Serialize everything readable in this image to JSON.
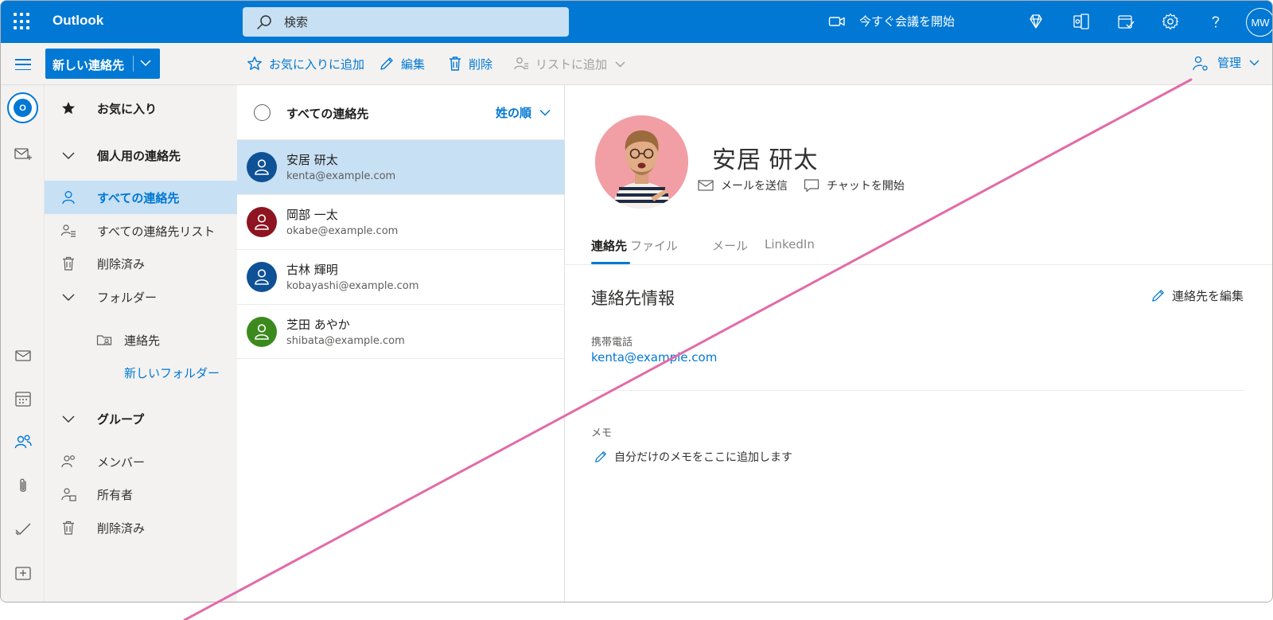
{
  "header": {
    "app_name": "Outlook",
    "search_placeholder": "検索",
    "meet_now": "今すぐ会議を開始",
    "user_initials": "MW"
  },
  "toolbar": {
    "new_contact": "新しい連絡先",
    "add_favorite": "お気に入りに追加",
    "edit": "編集",
    "delete": "削除",
    "add_to_list": "リストに追加",
    "manage": "管理"
  },
  "nav": {
    "favorites": "お気に入り",
    "personal_contacts": "個人用の連絡先",
    "all_contacts": "すべての連絡先",
    "all_contact_lists": "すべての連絡先リスト",
    "deleted": "削除済み",
    "folders": "フォルダー",
    "folder_contacts": "連絡先",
    "new_folder": "新しいフォルダー",
    "groups": "グループ",
    "member": "メンバー",
    "owner": "所有者",
    "groups_deleted": "削除済み"
  },
  "list": {
    "title": "すべての連絡先",
    "sort": "姓の順",
    "contacts": [
      {
        "name": "安居 研太",
        "email": "kenta@example.com",
        "color": "#0f5196"
      },
      {
        "name": "岡部 一太",
        "email": "okabe@example.com",
        "color": "#8e1421"
      },
      {
        "name": "古林 輝明",
        "email": "kobayashi@example.com",
        "color": "#0f5196"
      },
      {
        "name": "芝田 あやか",
        "email": "shibata@example.com",
        "color": "#3c8a1e"
      }
    ]
  },
  "detail": {
    "name": "安居 研太",
    "send_email": "メールを送信",
    "start_chat": "チャットを開始",
    "tabs": [
      "連絡先",
      "ファイル",
      "メール",
      "LinkedIn"
    ],
    "section_title": "連絡先情報",
    "edit_contact": "連絡先を編集",
    "mobile_label": "携帯電話",
    "mobile_value": "kenta@example.com",
    "memo_label": "メモ",
    "memo_add": "自分だけのメモをここに追加します"
  },
  "colors": {
    "brand": "#0078d4",
    "selection": "#c7e0f4",
    "annotation_line": "#e36aa8"
  }
}
